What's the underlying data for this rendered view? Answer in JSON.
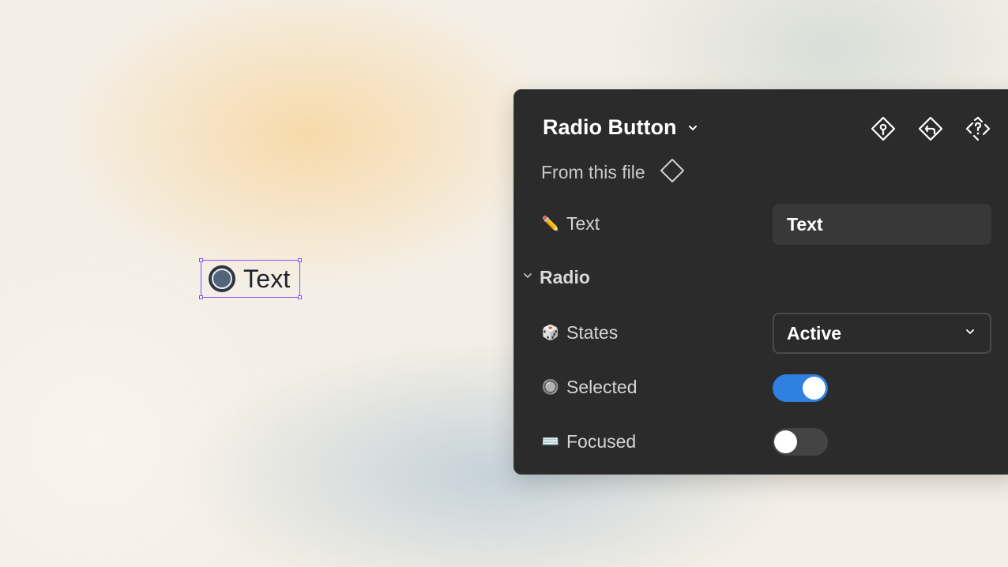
{
  "canvas": {
    "component_label": "Text"
  },
  "panel": {
    "title": "Radio Button",
    "source_label": "From this file",
    "header_icons": [
      "go-to-main-component-icon",
      "reset-instance-icon",
      "detach-instance-icon"
    ],
    "properties": {
      "text": {
        "emoji": "✏️",
        "label": "Text",
        "value": "Text"
      },
      "section": {
        "label": "Radio"
      },
      "states": {
        "emoji": "🎲",
        "label": "States",
        "value": "Active"
      },
      "selected": {
        "emoji": "🔘",
        "label": "Selected",
        "on": true
      },
      "focused": {
        "emoji": "⌨️",
        "label": "Focused",
        "on": false
      }
    }
  },
  "colors": {
    "selection": "#8a4dff",
    "panel_bg": "#2b2b2b",
    "toggle_on": "#2f80e0",
    "toggle_off": "#444444"
  }
}
